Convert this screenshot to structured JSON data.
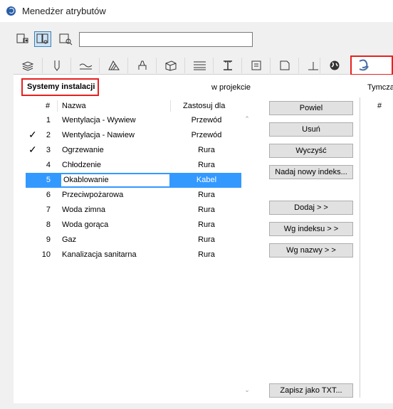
{
  "window": {
    "title": "Menedżer atrybutów"
  },
  "filter": {
    "value": ""
  },
  "section": {
    "title": "Systemy instalacji",
    "in_project": "w projekcie",
    "temp": "Tymcza"
  },
  "list": {
    "headers": {
      "num": "#",
      "name": "Nazwa",
      "use": "Zastosuj dla"
    },
    "rows": [
      {
        "checked": "",
        "num": "1",
        "name": "Wentylacja - Wywiew",
        "use": "Przewód"
      },
      {
        "checked": "✓",
        "num": "2",
        "name": "Wentylacja - Nawiew",
        "use": "Przewód"
      },
      {
        "checked": "✓",
        "num": "3",
        "name": "Ogrzewanie",
        "use": "Rura"
      },
      {
        "checked": "",
        "num": "4",
        "name": "Chłodzenie",
        "use": "Rura"
      },
      {
        "checked": "",
        "num": "5",
        "name": "Okablowanie",
        "use": "Kabel"
      },
      {
        "checked": "",
        "num": "6",
        "name": "Przeciwpożarowa",
        "use": "Rura"
      },
      {
        "checked": "",
        "num": "7",
        "name": "Woda zimna",
        "use": "Rura"
      },
      {
        "checked": "",
        "num": "8",
        "name": "Woda gorąca",
        "use": "Rura"
      },
      {
        "checked": "",
        "num": "9",
        "name": "Gaz",
        "use": "Rura"
      },
      {
        "checked": "",
        "num": "10",
        "name": "Kanalizacja sanitarna",
        "use": "Rura"
      }
    ]
  },
  "buttons": {
    "duplicate": "Powiel",
    "delete": "Usuń",
    "clear": "Wyczyść",
    "reindex": "Nadaj nowy indeks...",
    "add": "Dodaj > >",
    "by_index": "Wg indeksu > >",
    "by_name": "Wg nazwy > >",
    "save_txt": "Zapisz jako TXT..."
  },
  "right_list": {
    "header_num": "#"
  },
  "colors": {
    "accent": "#3399ff",
    "highlight": "#e8201e"
  }
}
